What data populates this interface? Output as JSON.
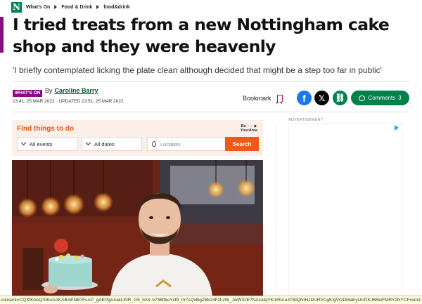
{
  "brand": {
    "logo_letter": "N",
    "accent": "#8a0b7f",
    "green": "#00804a"
  },
  "breadcrumb": [
    "What's On",
    "Food & Drink",
    "food&drink"
  ],
  "article": {
    "headline": "I tried treats from a new Nottingham cake shop and they were heavenly",
    "standfirst": "'I briefly contemplated licking the plate clean although decided that might be a step too far in public'",
    "badge": "WHAT'S ON",
    "by_prefix": "By",
    "author": "Caroline Barry",
    "published": "13:41, 25 MAR 2022",
    "updated": "UPDATED 13:51, 25 MAR 2022"
  },
  "actions": {
    "bookmark_label": "Bookmark",
    "facebook_glyph": "f",
    "x_glyph": "𝕏",
    "link_glyph": "⛓",
    "comments_label": "Comments",
    "comments_count": "3"
  },
  "widget": {
    "title": "Find things to do",
    "logo_line1": "Be ◌ ◌ ◆",
    "logo_line2": "YourArea",
    "events_value": "All events",
    "dates_value": "All dates",
    "location_placeholder": "Location",
    "search_label": "Search"
  },
  "ad": {
    "label": "ADVERTISEMENT"
  },
  "consent_url": "consent=CQXlKoAQXlKoAAKABAENB7FsAP_gAEPgAAwlLINR_G9_bXIr-b736ftkeYxf9_hr7sQxBgZBk24FzLvW_JwW32E7NAzatqYKmRiAu3TBIQNIHJDURVCgKIgVrzDMaEyUoTtKJ6BkiFMRY2NYCFxvm4"
}
